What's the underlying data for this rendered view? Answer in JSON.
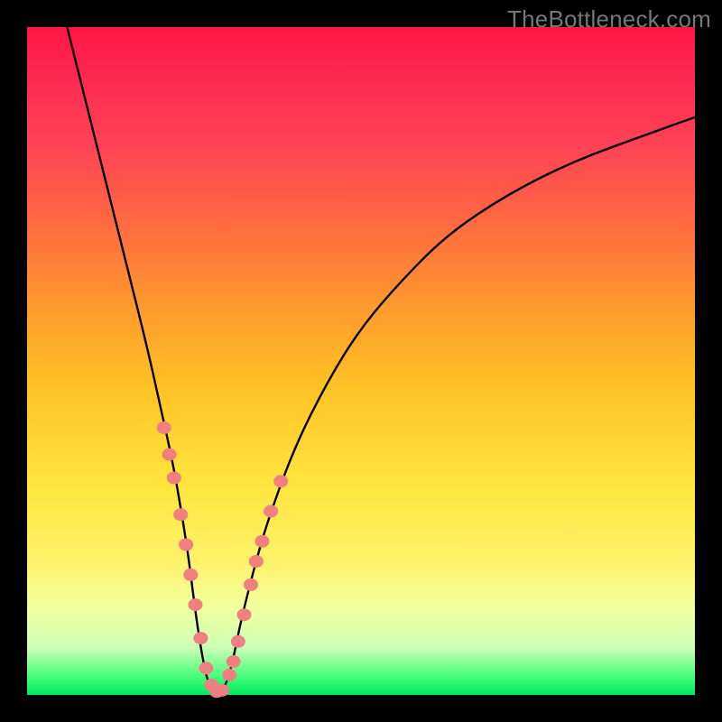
{
  "watermark": "TheBottleneck.com",
  "colors": {
    "background": "#000000",
    "curve_stroke": "#000000",
    "marker_fill": "#f08080",
    "gradient_top": "#ff1744",
    "gradient_bottom": "#00e860"
  },
  "chart_data": {
    "type": "line",
    "title": "",
    "xlabel": "",
    "ylabel": "",
    "xlim": [
      0,
      100
    ],
    "ylim": [
      0,
      100
    ],
    "curve": {
      "description": "V-shaped bottleneck curve with minimum near x≈27",
      "points_pct": [
        [
          6,
          100
        ],
        [
          9,
          88
        ],
        [
          12,
          76
        ],
        [
          15,
          64
        ],
        [
          18,
          52
        ],
        [
          20,
          43
        ],
        [
          22,
          34
        ],
        [
          24,
          22
        ],
        [
          25,
          14
        ],
        [
          26,
          7
        ],
        [
          27,
          2
        ],
        [
          28,
          0.5
        ],
        [
          29,
          0.5
        ],
        [
          30,
          2
        ],
        [
          31,
          6
        ],
        [
          32,
          11
        ],
        [
          34,
          19
        ],
        [
          36,
          26
        ],
        [
          40,
          37
        ],
        [
          45,
          47
        ],
        [
          50,
          55
        ],
        [
          56,
          62
        ],
        [
          63,
          69
        ],
        [
          72,
          75
        ],
        [
          82,
          80
        ],
        [
          93,
          84
        ],
        [
          100,
          86.5
        ]
      ]
    },
    "markers_pct": [
      [
        20.5,
        40
      ],
      [
        21.3,
        36
      ],
      [
        22.0,
        32.5
      ],
      [
        23.0,
        27
      ],
      [
        23.8,
        22.5
      ],
      [
        24.5,
        18
      ],
      [
        25.2,
        13.5
      ],
      [
        26.0,
        8.5
      ],
      [
        26.8,
        4
      ],
      [
        27.6,
        1.5
      ],
      [
        28.4,
        0.5
      ],
      [
        29.2,
        0.7
      ],
      [
        30.3,
        3
      ],
      [
        35.2,
        23
      ],
      [
        36.5,
        27.5
      ],
      [
        38.0,
        32
      ],
      [
        33.5,
        16.5
      ],
      [
        34.3,
        20
      ],
      [
        32.5,
        12
      ],
      [
        31.6,
        8
      ],
      [
        30.9,
        5
      ]
    ]
  }
}
